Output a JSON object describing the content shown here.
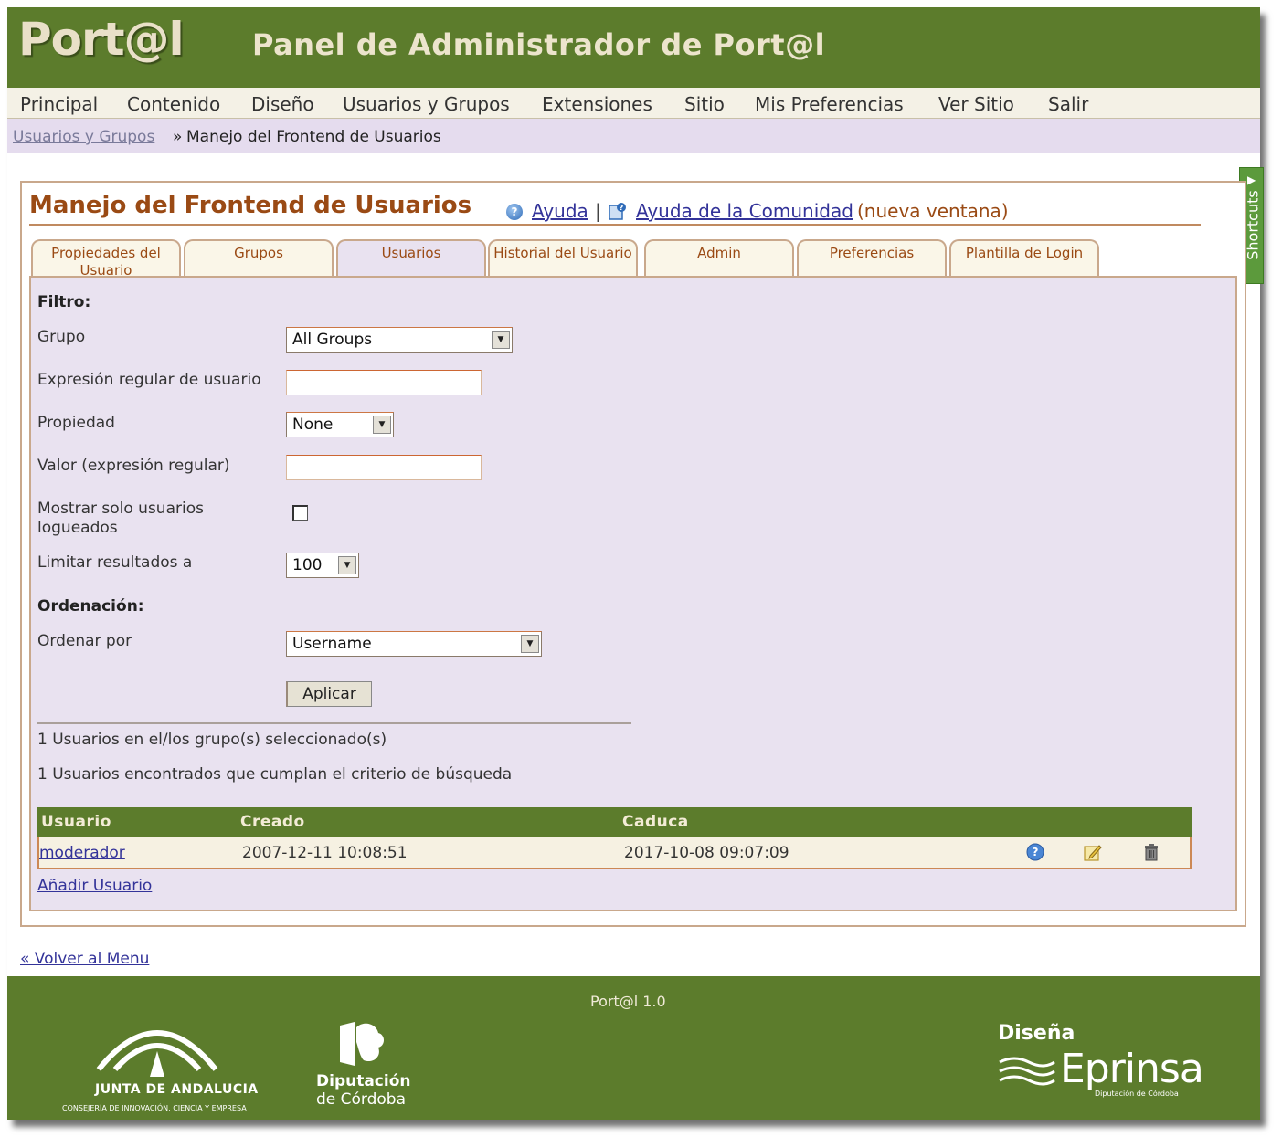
{
  "header": {
    "logo": "Port@l",
    "title": "Panel de Administrador de Port@l"
  },
  "menu": {
    "items": [
      "Principal",
      "Contenido",
      "Diseño",
      "Usuarios y Grupos",
      "Extensiones",
      "Sitio",
      "Mis Preferencias",
      "Ver Sitio",
      "Salir"
    ]
  },
  "breadcrumb": {
    "parent": "Usuarios y Grupos",
    "separator": "»",
    "current": "Manejo del Frontend de Usuarios"
  },
  "page": {
    "title": "Manejo del Frontend de Usuarios",
    "help": "Ayuda",
    "separator": "|",
    "community_help": "Ayuda de la Comunidad",
    "community_note": "(nueva ventana)"
  },
  "shortcuts": {
    "label": "Shortcuts",
    "arrow": "▶"
  },
  "tabs": [
    {
      "label": "Propiedades del Usuario"
    },
    {
      "label": "Grupos"
    },
    {
      "label": "Usuarios"
    },
    {
      "label": "Historial del Usuario"
    },
    {
      "label": "Admin"
    },
    {
      "label": "Preferencias"
    },
    {
      "label": "Plantilla de Login"
    }
  ],
  "filter": {
    "heading": "Filtro:",
    "group_label": "Grupo",
    "group_value": "All Groups",
    "regex_label": "Expresión regular de usuario",
    "regex_value": "",
    "property_label": "Propiedad",
    "property_value": "None",
    "value_label": "Valor (expresión regular)",
    "value_value": "",
    "logged_label": "Mostrar solo usuarios logueados",
    "logged_checked": false,
    "limit_label": "Limitar resultados a",
    "limit_value": "100"
  },
  "sort": {
    "heading": "Ordenación:",
    "order_label": "Ordenar por",
    "order_value": "Username",
    "apply": "Aplicar"
  },
  "results": {
    "in_groups": "1 Usuarios en el/los grupo(s) seleccionado(s)",
    "matching": "1 Usuarios encontrados que cumplan el criterio de búsqueda"
  },
  "table": {
    "headers": [
      "Usuario",
      "Creado",
      "Caduca"
    ],
    "rows": [
      {
        "user": "moderador",
        "created": "2007-12-11 10:08:51",
        "expires": "2017-10-08 09:07:09"
      }
    ],
    "row_icons": [
      "help-icon",
      "edit-icon",
      "trash-icon"
    ]
  },
  "add_user": "Añadir Usuario",
  "back": "« Volver al Menu",
  "footer": {
    "version": "Port@l 1.0",
    "junta_name": "JUNTA DE ANDALUCIA",
    "junta_sub": "CONSEJERÍA DE INNOVACIÓN, CIENCIA Y EMPRESA",
    "diputacion_1": "Diputación",
    "diputacion_2": "de Córdoba",
    "disena": "Diseña",
    "eprinsa": "Eprinsa",
    "eprinsa_sub": "Diputación de Córdoba"
  },
  "colors": {
    "header_green": "#5c7c2c",
    "accent_orange": "#9a4a14",
    "panel_lavender": "#e9e2f0",
    "shortcut_green": "#5c9a3c"
  }
}
